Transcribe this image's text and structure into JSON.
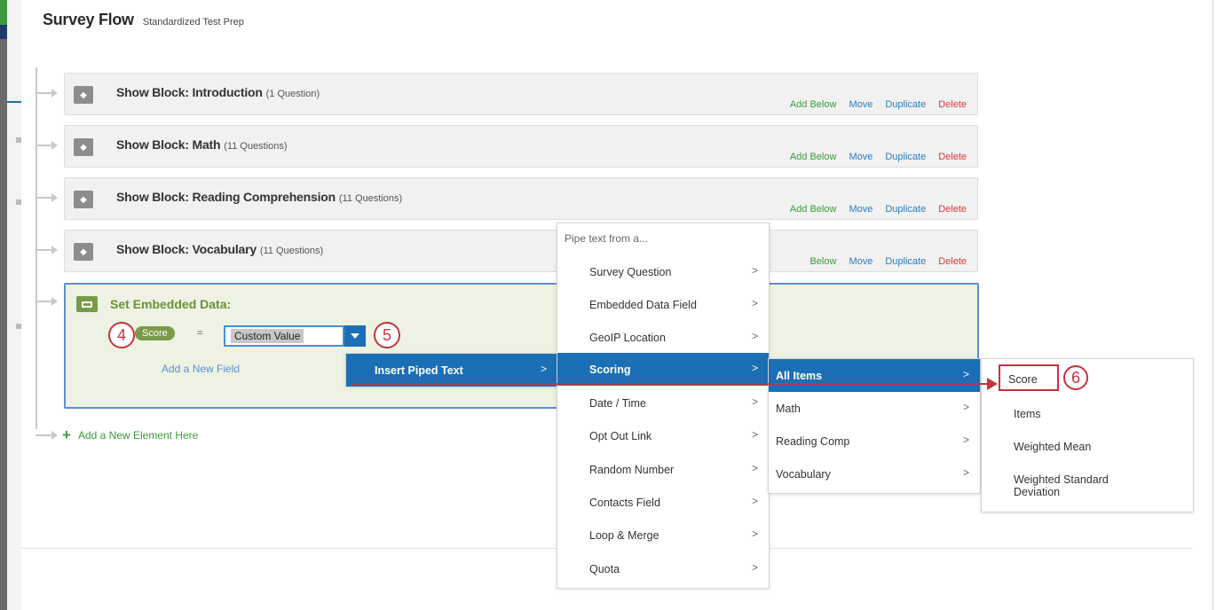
{
  "header": {
    "title": "Survey Flow",
    "subtitle": "Standardized Test Prep"
  },
  "blocks": [
    {
      "name": "Show Block: Introduction",
      "count": "(1 Question)"
    },
    {
      "name": "Show Block: Math",
      "count": "(11 Questions)"
    },
    {
      "name": "Show Block: Reading Comprehension",
      "count": "(11 Questions)"
    },
    {
      "name": "Show Block: Vocabulary",
      "count": "(11 Questions)"
    }
  ],
  "block_actions": {
    "add_below": "Add Below",
    "add_below_partial": "Below",
    "move": "Move",
    "duplicate": "Duplicate",
    "delete": "Delete"
  },
  "embedded": {
    "title": "Set Embedded Data:",
    "field_name": "Score",
    "equals": "=",
    "value": "Custom Value",
    "add_field": "Add a New Field"
  },
  "add_element": "Add a New Element Here",
  "steps": {
    "s4": "4",
    "s5": "5",
    "s6": "6"
  },
  "menu_piped": {
    "item": "Insert Piped Text",
    "chevron": ">"
  },
  "menu_sources": {
    "header": "Pipe text from a...",
    "items": [
      "Survey Question",
      "Embedded Data Field",
      "GeoIP Location",
      "Scoring",
      "Date / Time",
      "Opt Out Link",
      "Random Number",
      "Contacts Field",
      "Loop & Merge",
      "Quota"
    ]
  },
  "menu_scoring": {
    "items": [
      "All Items",
      "Math",
      "Reading Comp",
      "Vocabulary"
    ]
  },
  "menu_scores": {
    "items": [
      "Score",
      "Items",
      "Weighted Mean",
      "Weighted Standard",
      "Deviation"
    ]
  },
  "colors": {
    "accent_blue": "#1a6fb5",
    "add_green": "#3a9a3a",
    "delete_red": "#d23b3b",
    "annotation_red": "#c8323c",
    "embedded_green": "#7a9a4a"
  },
  "icons": {
    "block": "cube-icon",
    "embedded": "embedded-data-icon",
    "chevron": "chevron-right-icon"
  }
}
